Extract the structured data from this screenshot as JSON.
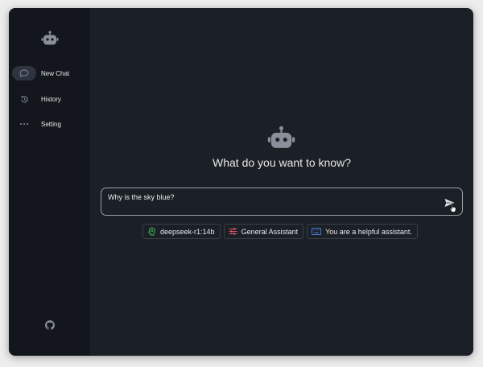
{
  "sidebar": {
    "items": [
      {
        "label": "New Chat",
        "icon": "chat-bubble-icon",
        "active": true
      },
      {
        "label": "History",
        "icon": "history-icon",
        "active": false
      },
      {
        "label": "Setting",
        "icon": "more-dots-icon",
        "active": false
      }
    ],
    "footer_icon": "github-icon"
  },
  "main": {
    "headline": "What do you want to know?",
    "input": {
      "value": "Why is the sky blue?"
    },
    "chips": [
      {
        "label": "deepseek-r1:14b",
        "icon": "brain-icon",
        "icon_color": "#3fbf5a"
      },
      {
        "label": "General Assistant",
        "icon": "sliders-icon",
        "icon_color": "#e0556a"
      },
      {
        "label": "You are a helpful assistant.",
        "icon": "keyboard-icon",
        "icon_color": "#4a7fe0"
      }
    ]
  },
  "colors": {
    "window_bg": "#1b1f26",
    "sidebar_bg": "#13161c",
    "text": "#e8e9eb",
    "muted_icon": "#8a9099"
  }
}
